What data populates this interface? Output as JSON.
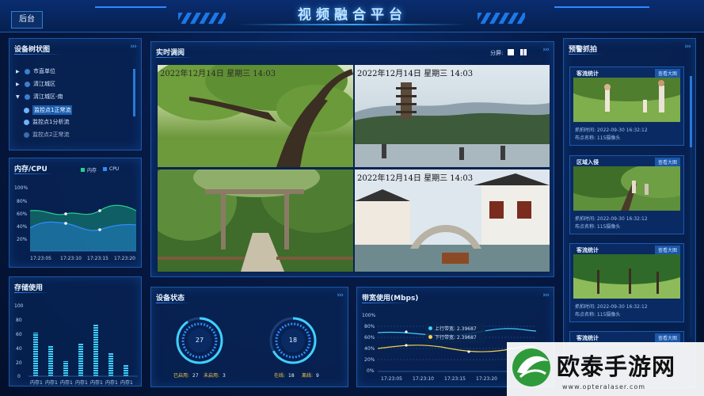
{
  "header": {
    "title": "视频融合平台",
    "back_label": "后台"
  },
  "device_tree": {
    "title": "设备树状图",
    "items": [
      {
        "label": "市直单位",
        "expanded": false
      },
      {
        "label": "清江城区",
        "expanded": false
      },
      {
        "label": "清江城区-南",
        "expanded": true
      },
      {
        "label": "监控点1正常流",
        "active": true
      },
      {
        "label": "监控点1分析流",
        "active": false
      },
      {
        "label": "监控点2正常流",
        "active": false
      }
    ]
  },
  "memory_cpu": {
    "title": "内存/CPU",
    "legend": [
      "内存",
      "CPU"
    ],
    "colors": {
      "memory": "#22d18b",
      "cpu": "#2e8cff"
    },
    "y_ticks": [
      "100%",
      "80%",
      "60%",
      "40%",
      "20%"
    ],
    "x_ticks": [
      "17:23:05",
      "17:23:10",
      "17:23:15",
      "17:23:20"
    ]
  },
  "storage": {
    "title": "存储使用",
    "y_ticks": [
      "100",
      "80",
      "60",
      "40",
      "20",
      "0"
    ],
    "x_ticks": [
      "内存1",
      "内存1",
      "内存1",
      "内存1",
      "内存1",
      "内存1",
      "内存1"
    ]
  },
  "live": {
    "title": "实时调阅",
    "split_label": "分屏:",
    "timestamps": [
      "2022年12月14日 星期三 14:03",
      "2022年12月14日 星期三 14:03",
      "2022年12月14日 星期三 14:03"
    ],
    "timestamp_top_left": "2022年12月14日 星期三 14:03"
  },
  "device_status": {
    "title": "设备状态",
    "gauge1": {
      "value": "27"
    },
    "gauge2": {
      "value": "18"
    },
    "stats": {
      "started_label": "已启用:",
      "started": "27",
      "not_started_label": "未启用:",
      "not_started": "3",
      "online_label": "在线:",
      "online": "18",
      "offline_label": "离线:",
      "offline": "9"
    }
  },
  "bandwidth": {
    "title": "带宽使用(Mbps)",
    "legend_up": "上行带宽: 2.39687",
    "legend_down": "下行带宽: 2.39687",
    "y_ticks": [
      "100%",
      "80%",
      "60%",
      "40%",
      "20%",
      "0%"
    ],
    "x_ticks": [
      "17:23:05",
      "17:23:10",
      "17:23:15",
      "17:23:20"
    ]
  },
  "alarms": {
    "title": "预警抓拍",
    "view_label": "查看大图",
    "cards": [
      {
        "type": "客流统计",
        "time": "抓拍时间: 2022-09-30 16:32:12",
        "place": "布点名称: 115摄像头"
      },
      {
        "type": "区域入侵",
        "time": "抓拍时间: 2022-09-30 16:32:12",
        "place": "布点名称: 115摄像头"
      },
      {
        "type": "客流统计",
        "time": "抓拍时间: 2022-09-30 16:32:12",
        "place": "布点名称: 115摄像头"
      },
      {
        "type": "客流统计",
        "time": "",
        "place": ""
      }
    ]
  },
  "watermark": {
    "text": "欧泰手游网",
    "url": "www.opteralaser.com"
  }
}
